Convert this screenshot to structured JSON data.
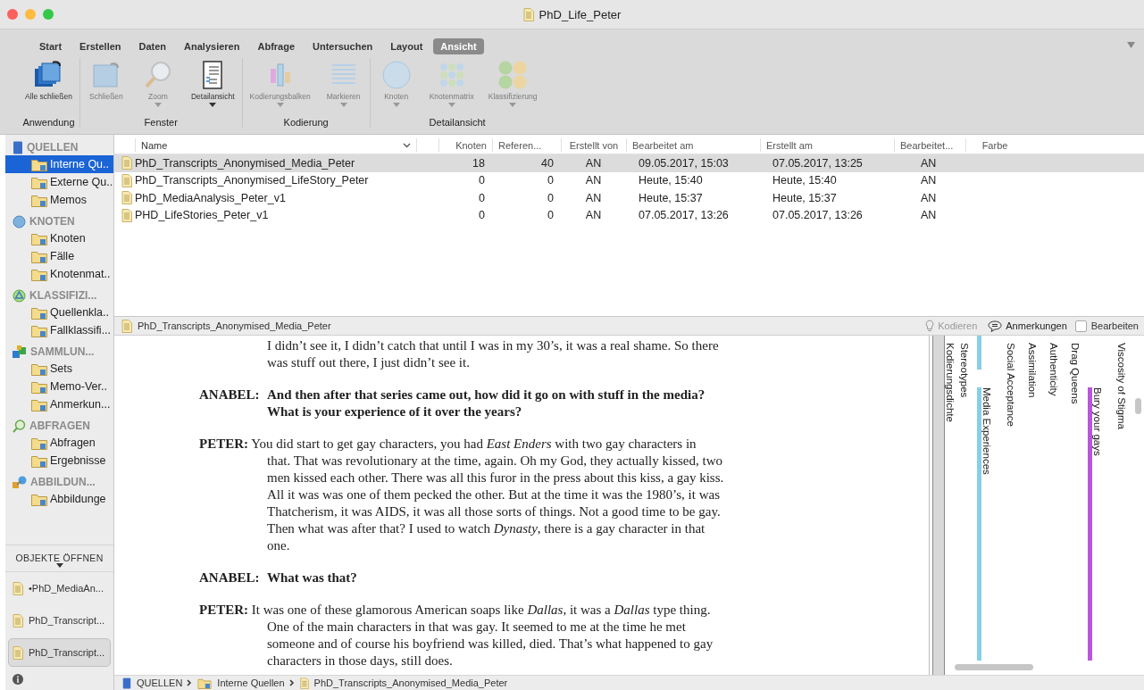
{
  "window": {
    "title": "PhD_Life_Peter"
  },
  "ribbon": {
    "tabs": [
      {
        "label": "Start",
        "selected": false
      },
      {
        "label": "Erstellen",
        "selected": false
      },
      {
        "label": "Daten",
        "selected": false
      },
      {
        "label": "Analysieren",
        "selected": false
      },
      {
        "label": "Abfrage",
        "selected": false
      },
      {
        "label": "Untersuchen",
        "selected": false
      },
      {
        "label": "Layout",
        "selected": false
      },
      {
        "label": "Ansicht",
        "selected": true
      }
    ],
    "groups": [
      {
        "label": "Anwendung",
        "buttons": [
          {
            "kind": "stack",
            "label": "Alle schließen",
            "disabled": false,
            "dropdown": false
          }
        ]
      },
      {
        "label": "Fenster",
        "buttons": [
          {
            "kind": "window",
            "label": "Schließen",
            "disabled": true,
            "dropdown": false
          },
          {
            "kind": "zoom",
            "label": "Zoom",
            "disabled": true,
            "dropdown": true
          },
          {
            "kind": "detail",
            "label": "Detailansicht",
            "disabled": false,
            "dropdown": true
          }
        ]
      },
      {
        "label": "Kodierung",
        "buttons": [
          {
            "kind": "bars",
            "label": "Kodierungsbalken",
            "disabled": true,
            "dropdown": true
          },
          {
            "kind": "lines",
            "label": "Markieren",
            "disabled": true,
            "dropdown": true
          }
        ]
      },
      {
        "label": "Detailansicht",
        "buttons": [
          {
            "kind": "sphere",
            "label": "Knoten",
            "disabled": true,
            "dropdown": true
          },
          {
            "kind": "grid",
            "label": "Knotenmatrix",
            "disabled": true,
            "dropdown": true
          },
          {
            "kind": "circles",
            "label": "Klassifizierung",
            "disabled": true,
            "dropdown": true
          }
        ]
      }
    ]
  },
  "sidebar": {
    "sections": [
      {
        "kind": "book",
        "label": "QUELLEN",
        "items": [
          {
            "label": "Interne Qu..",
            "selected": true
          },
          {
            "label": "Externe Qu..",
            "selected": false
          },
          {
            "label": "Memos",
            "selected": false
          }
        ]
      },
      {
        "kind": "sphere",
        "label": "KNOTEN",
        "items": [
          {
            "label": "Knoten",
            "selected": false
          },
          {
            "label": "Fälle",
            "selected": false
          },
          {
            "label": "Knotenmat..",
            "selected": false
          }
        ]
      },
      {
        "kind": "triangle",
        "label": "KLASSIFIZI...",
        "items": [
          {
            "label": "Quellenkla..",
            "selected": false
          },
          {
            "label": "Fallklassifi...",
            "selected": false
          }
        ]
      },
      {
        "kind": "cubes",
        "label": "SAMMLUN...",
        "items": [
          {
            "label": "Sets",
            "selected": false
          },
          {
            "label": "Memo-Ver..",
            "selected": false
          },
          {
            "label": "Anmerkun...",
            "selected": false
          }
        ]
      },
      {
        "kind": "search",
        "label": "ABFRAGEN",
        "items": [
          {
            "label": "Abfragen",
            "selected": false
          },
          {
            "label": "Ergebnisse",
            "selected": false
          }
        ]
      },
      {
        "kind": "shapes",
        "label": "ABBILDUN...",
        "items": [
          {
            "label": "Abbildunge",
            "selected": false
          }
        ]
      }
    ],
    "open_objects": {
      "title": "OBJEKTE ÖFFNEN",
      "items": [
        {
          "label": "•PhD_MediaAn...",
          "selected": false
        },
        {
          "label": "PhD_Transcript...",
          "selected": false
        },
        {
          "label": "PhD_Transcript...",
          "selected": true
        }
      ]
    }
  },
  "table": {
    "columns": [
      "Name",
      "Knoten",
      "Referen...",
      "Erstellt von",
      "Bearbeitet am",
      "Erstellt am",
      "Bearbeitet...",
      "Farbe"
    ],
    "rows": [
      {
        "selected": true,
        "cells": [
          "PhD_Transcripts_Anonymised_Media_Peter",
          "18",
          "40",
          "AN",
          "09.05.2017, 15:03",
          "07.05.2017, 13:25",
          "AN"
        ]
      },
      {
        "selected": false,
        "cells": [
          "PhD_Transcripts_Anonymised_LifeStory_Peter",
          "0",
          "0",
          "AN",
          "Heute, 15:40",
          "Heute, 15:40",
          "AN"
        ]
      },
      {
        "selected": false,
        "cells": [
          "PhD_MediaAnalysis_Peter_v1",
          "0",
          "0",
          "AN",
          "Heute, 15:37",
          "Heute, 15:37",
          "AN"
        ]
      },
      {
        "selected": false,
        "cells": [
          "PHD_LifeStories_Peter_v1",
          "0",
          "0",
          "AN",
          "07.05.2017, 13:26",
          "07.05.2017, 13:26",
          "AN"
        ]
      }
    ]
  },
  "detail": {
    "title": "PhD_Transcripts_Anonymised_Media_Peter",
    "actions": [
      {
        "kind": "code",
        "label": "Kodieren",
        "disabled": true
      },
      {
        "kind": "annotations",
        "label": "Anmerkungen",
        "disabled": false
      }
    ],
    "edit": {
      "label": "Bearbeiten",
      "checked": false
    },
    "transcript": [
      {
        "kind": "continuation",
        "lines": [
          "I didn’t see it, I didn’t catch that until I was in my 30’s, it was a real shame. So there",
          "was stuff out there, I just didn’t see it."
        ]
      },
      {
        "kind": "question",
        "speaker": "ANABEL:",
        "lines": [
          "And then after that series came out, how did it go on with stuff in the media?",
          "What is your experience of it over the years?"
        ]
      },
      {
        "kind": "answer",
        "speaker": "PETER:",
        "lines": [
          "You did start to get gay characters, you had *East Enders* with two gay characters in",
          "that. That was revolutionary at the time, again. Oh my God, they actually kissed, two",
          "men kissed each other. There was all this furor in the press about this kiss, a gay kiss.",
          "All it was was one of them pecked the other. But at the time it was the 1980’s, it was",
          "Thatcherism, it was AIDS, it was all those sorts of things. Not a good time to be gay.",
          "Then what was after that? I used to watch *Dynasty*, there is a gay character in that",
          "one."
        ]
      },
      {
        "kind": "question",
        "speaker": "ANABEL:",
        "lines": [
          "What was that?"
        ]
      },
      {
        "kind": "answer",
        "speaker": "PETER:",
        "lines": [
          "It was one of these glamorous American soaps like *Dallas*, it was a *Dallas* type thing.",
          "One of the main characters in that was gay. It seemed to me at the time he met",
          "someone and of course his boyfriend was killed, died. That’s what happened to gay",
          "characters in those days, still does."
        ]
      }
    ],
    "stripes": [
      {
        "kind": "density",
        "label": "Kodierungsdichte"
      },
      {
        "kind": "label",
        "label": "Stereotypes"
      },
      {
        "kind": "stripe",
        "label": "Media Experiences",
        "color": "#87ceeb",
        "continues_above": true
      },
      {
        "kind": "label",
        "label": "Social Acceptance"
      },
      {
        "kind": "label",
        "label": "Assimilation"
      },
      {
        "kind": "label",
        "label": "Authenticity"
      },
      {
        "kind": "label",
        "label": "Drag Queens"
      },
      {
        "kind": "stripe",
        "label": "Bury your gays",
        "color": "#bb55dd",
        "continues_above": false
      },
      {
        "kind": "label",
        "label": "Viscosity of Stigma"
      }
    ]
  },
  "breadcrumb": [
    {
      "kind": "book",
      "label": "QUELLEN"
    },
    {
      "kind": "folder",
      "label": "Interne Quellen"
    },
    {
      "kind": "doc",
      "label": "PhD_Transcripts_Anonymised_Media_Peter"
    }
  ]
}
